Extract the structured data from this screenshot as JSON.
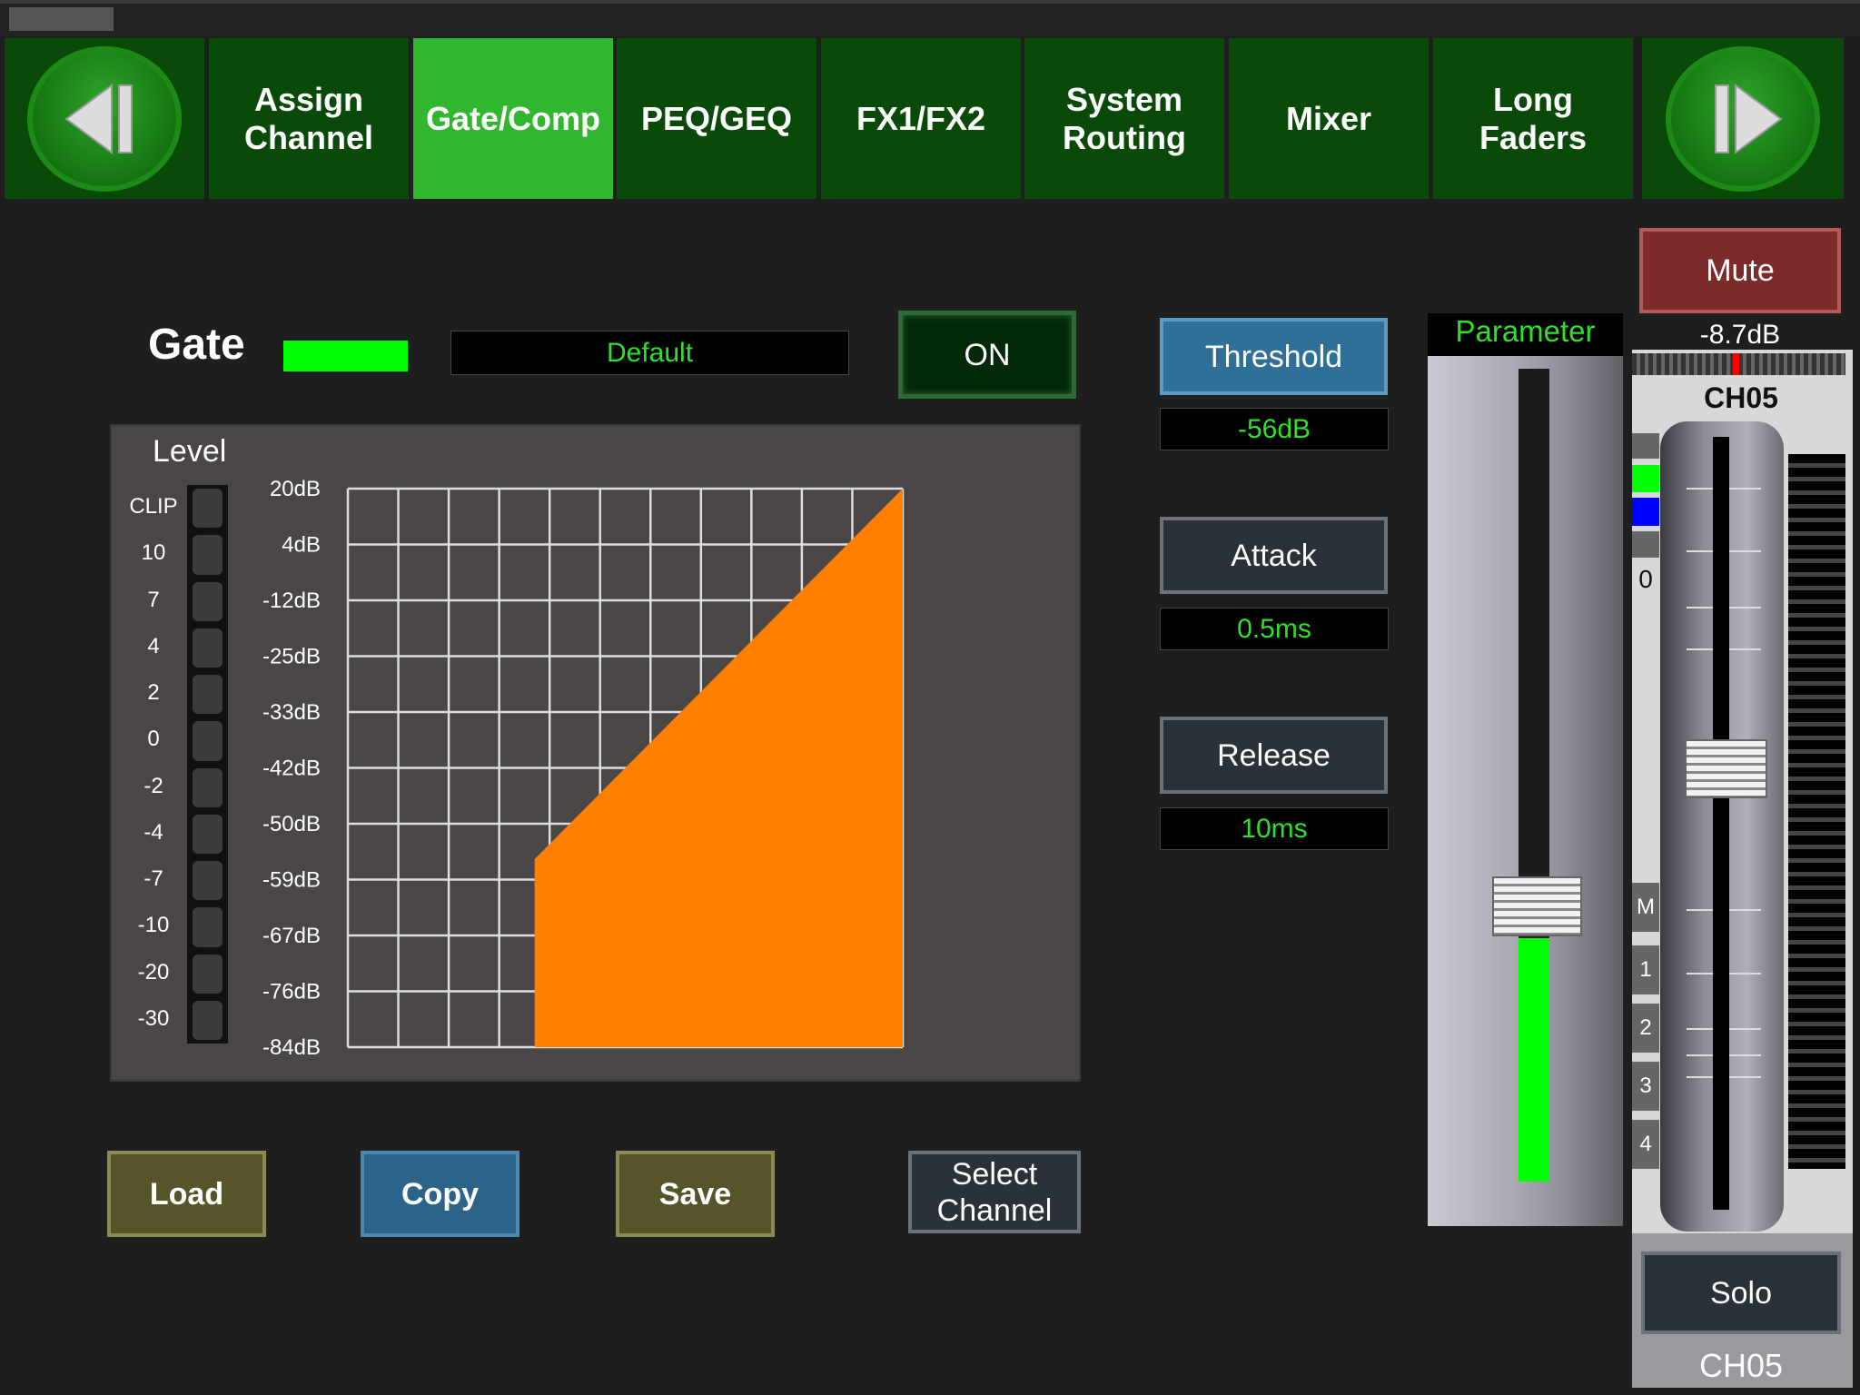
{
  "nav": {
    "prev_icon": "skip-back-icon",
    "next_icon": "skip-forward-icon",
    "tabs": [
      {
        "label": "Assign\nChannel",
        "active": false
      },
      {
        "label": "Gate/Comp",
        "active": true
      },
      {
        "label": "PEQ/GEQ",
        "active": false
      },
      {
        "label": "FX1/FX2",
        "active": false
      },
      {
        "label": "System\nRouting",
        "active": false
      },
      {
        "label": "Mixer",
        "active": false
      },
      {
        "label": "Long\nFaders",
        "active": false
      }
    ]
  },
  "gate": {
    "title": "Gate",
    "indicator_color": "#00ff00",
    "preset": "Default",
    "on_label": "ON"
  },
  "level": {
    "label": "Level",
    "scale": [
      "CLIP",
      "10",
      "7",
      "4",
      "2",
      "0",
      "-2",
      "-4",
      "-7",
      "-10",
      "-20",
      "-30"
    ]
  },
  "gate_graph": {
    "y_ticks": [
      "20dB",
      "4dB",
      "-12dB",
      "-25dB",
      "-33dB",
      "-42dB",
      "-50dB",
      "-59dB",
      "-67dB",
      "-76dB",
      "-84dB"
    ],
    "range_db": [
      -84,
      20
    ],
    "fill_color": "#ff8000",
    "curve_points": [
      [
        -49,
        -84
      ],
      [
        -49,
        -49
      ],
      [
        20,
        20
      ],
      [
        20,
        -84
      ]
    ]
  },
  "actions": {
    "load": "Load",
    "copy": "Copy",
    "save": "Save",
    "select_channel": "Select\nChannel"
  },
  "params": {
    "threshold_label": "Threshold",
    "threshold_value": "-56dB",
    "attack_label": "Attack",
    "attack_value": "0.5ms",
    "release_label": "Release",
    "release_value": "10ms"
  },
  "parameter_fader": {
    "label": "Parameter",
    "level_fraction": 0.3
  },
  "channel": {
    "mute_label": "Mute",
    "gain": "-8.7dB",
    "name": "CH05",
    "zero_label": "0",
    "bus_labels": [
      "M",
      "1",
      "2",
      "3",
      "4"
    ],
    "fader_position_fraction": 0.55,
    "solo_label": "Solo",
    "footer_name": "CH05"
  }
}
